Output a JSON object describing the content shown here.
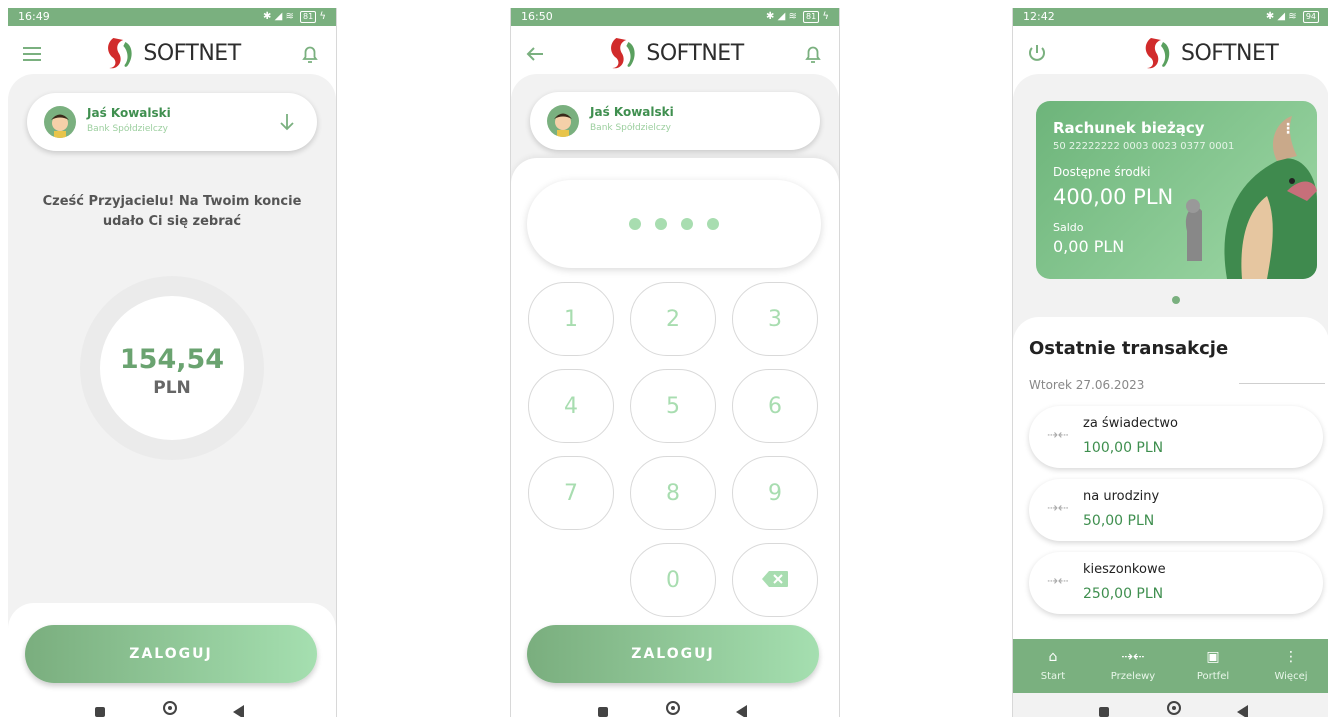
{
  "brand": {
    "name": "SOFTNET",
    "red": "#d12b2b",
    "green": "#7ab07f"
  },
  "screens": [
    {
      "status": {
        "time": "16:49",
        "battery": "81"
      },
      "user": {
        "name": "Jaś Kowalski",
        "bank": "Bank Spółdzielczy"
      },
      "greeting": "Cześć Przyjacielu! Na Twoim koncie udało Ci się zebrać",
      "balance": {
        "amount": "154,54",
        "currency": "PLN"
      },
      "login_label": "ZALOGUJ"
    },
    {
      "status": {
        "time": "16:50",
        "battery": "81"
      },
      "user": {
        "name": "Jaś Kowalski",
        "bank": "Bank Spółdzielczy"
      },
      "pin_filled": 4,
      "keys": [
        "1",
        "2",
        "3",
        "4",
        "5",
        "6",
        "7",
        "8",
        "9",
        "0"
      ],
      "login_label": "ZALOGUJ"
    },
    {
      "status": {
        "time": "12:42",
        "battery": "94"
      },
      "account": {
        "name": "Rachunek bieżący",
        "number": "50 22222222 0003 0023 0377 0001",
        "available_label": "Dostępne środki",
        "available": "400,00 PLN",
        "saldo_label": "Saldo",
        "saldo": "0,00 PLN"
      },
      "transactions_title": "Ostatnie transakcje",
      "date": "Wtorek 27.06.2023",
      "transactions": [
        {
          "title": "za świadectwo",
          "amount": "100,00 PLN"
        },
        {
          "title": "na urodziny",
          "amount": "50,00 PLN"
        },
        {
          "title": "kieszonkowe",
          "amount": "250,00 PLN"
        }
      ],
      "tabs": [
        {
          "label": "Start",
          "icon": "home-icon"
        },
        {
          "label": "Przelewy",
          "icon": "transfer-icon"
        },
        {
          "label": "Portfel",
          "icon": "wallet-icon"
        },
        {
          "label": "Więcej",
          "icon": "more-vertical-icon"
        }
      ]
    }
  ]
}
